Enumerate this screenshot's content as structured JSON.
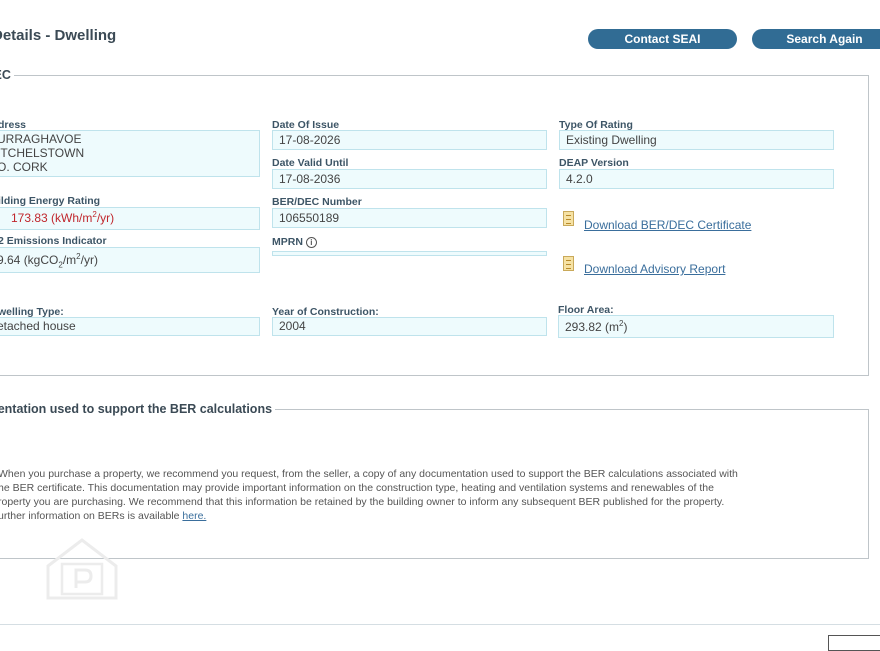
{
  "page": {
    "title": "Details - Dwelling"
  },
  "toolbar": {
    "contact": "Contact SEAI",
    "search": "Search Again"
  },
  "ber": {
    "legend": "R/DEC",
    "address_label": "dress",
    "address_lines": [
      "URRAGHAVOE",
      "ITCHELSTOWN",
      "O. CORK"
    ],
    "date_issue_label": "Date Of Issue",
    "date_issue": "17-08-2026",
    "type_rating_label": "Type Of Rating",
    "type_rating": "Existing Dwelling",
    "date_valid_label": "Date Valid Until",
    "date_valid": "17-08-2036",
    "deap_label": "DEAP Version",
    "deap": "4.2.0",
    "energy_label": "ilding Energy Rating",
    "energy_value": "173.83",
    "energy_unit_pre": "(kWh/m",
    "energy_unit_sup": "2",
    "energy_unit_post": "/yr)",
    "ber_number_label": "BER/DEC Number",
    "ber_number": "106550189",
    "co2_label": "2 Emissions Indicator",
    "co2_value": "9.64 (kgCO",
    "co2_sub": "2",
    "co2_mid": "/m",
    "co2_sup": "2",
    "co2_post": "/yr)",
    "mprn_label": "MPRN",
    "mprn_info": "i",
    "cert_link": "Download BER/DEC Certificate",
    "advisory_link": "Download Advisory Report",
    "dwelling_label": "welling Type:",
    "dwelling": "etached house",
    "year_label": "Year of Construction:",
    "year": "2004",
    "floor_label": "Floor Area:",
    "floor_value": "293.82 (m",
    "floor_sup": "2",
    "floor_post": ")"
  },
  "docs": {
    "legend": "cumentation used to support the BER calculations",
    "lines": [
      "When you purchase a property, we recommend you request, from the seller, a copy of any documentation used to support the BER calculations associated with",
      "he BER certificate. This documentation may provide important information on the construction type, heating and ventilation systems and renewables of the",
      "roperty you are purchasing. We recommend that this information be retained by the building owner to inform any subsequent BER published for the property."
    ],
    "last_prefix": "urther information on BERs is available ",
    "link": "here."
  }
}
